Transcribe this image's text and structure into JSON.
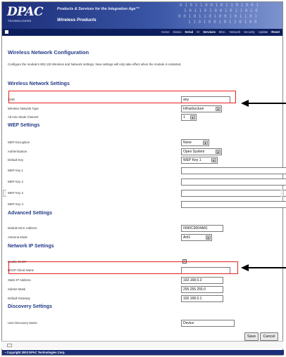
{
  "header": {
    "logo": "DPAC",
    "logo_sub": "TECHNOLOGIES",
    "tagline": "Products & Services for the Integration Age™",
    "product": "Wireless Products"
  },
  "nav": {
    "links": [
      {
        "label": "Home",
        "bold": false
      },
      {
        "label": "Status",
        "bold": false
      },
      {
        "label": "Serial",
        "bold": true
      },
      {
        "label": "IO",
        "bold": false
      },
      {
        "label": "Services",
        "bold": true
      },
      {
        "label": "Misc.",
        "bold": false
      },
      {
        "label": "Network",
        "bold": false
      },
      {
        "label": "Security",
        "bold": false
      },
      {
        "label": "Update",
        "bold": false
      },
      {
        "label": "Reset",
        "bold": true
      }
    ]
  },
  "page": {
    "title": "Wireless Network Configuration",
    "intro": "Configure the module's 802.11b Wireless and Network settings. New settings will only take effect when the module is restarted."
  },
  "wireless": {
    "title": "Wireless Network Settings",
    "ssid_label": "SSID",
    "ssid_value": "any",
    "network_type_label": "Wireless Network Type",
    "network_type_value": "Infrastructure",
    "adhoc_channel_label": "Ad-Hoc Mode Channel",
    "adhoc_channel_value": "1"
  },
  "wep": {
    "title": "WEP Settings",
    "encryption_label": "WEP Encryption",
    "encryption_value": "None",
    "auth_label": "Authentication",
    "auth_value": "Open System",
    "default_key_label": "Default Key",
    "default_key_value": "WEP Key 1",
    "key1_label": "WEP Key 1",
    "key2_label": "WEP Key 2",
    "key3_label": "WEP Key 3",
    "key4_label": "WEP Key 4"
  },
  "advanced": {
    "title": "Advanced Settings",
    "mac_label": "Module MAC Address",
    "mac_value": "0090C9004A81",
    "antenna_label": "Antenna Mode",
    "antenna_value": "Ant1"
  },
  "network_ip": {
    "title": "Network IP Settings",
    "dhcp_label": "Enable DHCP",
    "dhcp_checked": "✓",
    "client_name_label": "DHCP Client Name",
    "client_name_value": "",
    "static_ip_label": "Static IP Address",
    "static_ip_value": "192.168.0.3",
    "subnet_label": "Subnet Mask",
    "subnet_value": "255.255.255.0",
    "gateway_label": "Default Gateway",
    "gateway_value": "192.168.0.1"
  },
  "discovery": {
    "title": "Discovery Settings",
    "name_label": "User Discovery Name",
    "name_value": "Device"
  },
  "buttons": {
    "save": "Save",
    "cancel": "Cancel"
  },
  "footer": {
    "copyright": "▪ Copyright 2003 DPAC Technologies Corp."
  },
  "colors": {
    "accent": "#223a87",
    "highlight": "#e32020",
    "banner": "#1c2e78"
  }
}
